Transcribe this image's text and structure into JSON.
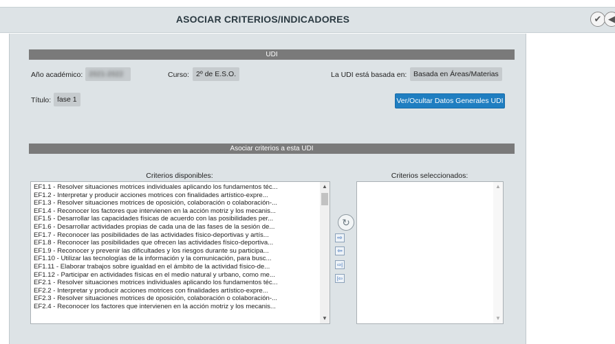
{
  "window": {
    "title": "ASOCIAR CRITERIOS/INDICADORES"
  },
  "toolbar": {
    "confirm_icon": "check-icon",
    "back_icon": "back-arrow-icon"
  },
  "udi": {
    "section_title": "UDI",
    "anio_label": "Año académico:",
    "anio_value": "2021-2022",
    "curso_label": "Curso:",
    "curso_value": "2º de E.S.O.",
    "basada_label": "La UDI está basada en:",
    "basada_value": "Basada en Áreas/Materias",
    "titulo_label": "Título:",
    "titulo_value": "fase 1",
    "toggle_button": "Ver/Ocultar Datos Generales UDI"
  },
  "asociar": {
    "section_title": "Asociar criterios a esta UDI",
    "disponibles_title": "Criterios disponibles:",
    "seleccionados_title": "Criterios seleccionados:",
    "disponibles": [
      "EF1.1 - Resolver situaciones motrices individuales aplicando los fundamentos téc...",
      "EF1.2 - Interpretar y producir acciones motrices con finalidades artístico-expre...",
      "EF1.3 - Resolver situaciones motrices de oposición, colaboración o colaboración-...",
      "EF1.4 - Reconocer los factores que intervienen en la acción motriz y los mecanis...",
      "EF1.5 - Desarrollar las capacidades físicas de acuerdo con las posibilidades per...",
      "EF1.6 - Desarrollar actividades propias de cada una de las fases de la sesión de...",
      "EF1.7 - Reconocer las posibilidades de las actividades físico-deportivas y artís...",
      "EF1.8 - Reconocer las posibilidades que ofrecen las actividades físico-deportiva...",
      "EF1.9 - Reconocer y prevenir las dificultades y los riesgos durante su participa...",
      "EF1.10 - Utilizar las tecnologías de la información y la comunicación, para busc...",
      "EF1.11 - Elaborar trabajos sobre igualdad en el ámbito de la actividad físico-de...",
      "EF1.12 - Participar en actividades físicas en el medio natural y urbano, como me...",
      "EF2.1 - Resolver situaciones motrices individuales aplicando los fundamentos téc...",
      "EF2.2 - Interpretar y producir acciones motrices con finalidades artístico-expre...",
      "EF2.3 - Resolver situaciones motrices de oposición, colaboración o colaboración-...",
      "EF2.4 - Reconocer los factores que intervienen en la acción motriz y los mecanis..."
    ],
    "seleccionados": [],
    "tools": {
      "refresh_icon": "refresh-icon",
      "add_one": "⇨",
      "remove_one": "⇦",
      "add_all": "⇨|",
      "remove_all": "|⇦"
    }
  },
  "colors": {
    "accent_button": "#1f7ec1",
    "section_bar": "#7a7a7a",
    "panel_bg": "#dde3e6"
  }
}
